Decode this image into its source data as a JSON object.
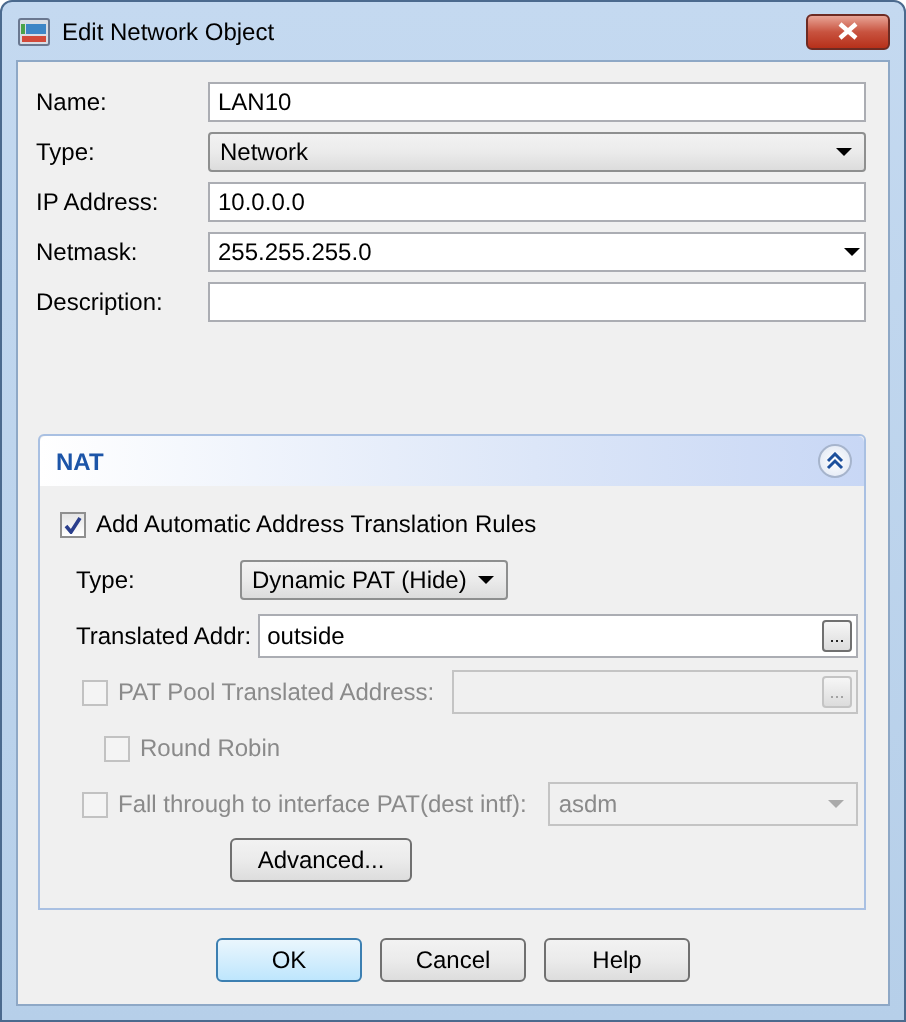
{
  "window": {
    "title": "Edit Network Object"
  },
  "fields": [
    {
      "label": "Name:",
      "kind": "text",
      "value": "LAN10"
    },
    {
      "label": "Type:",
      "kind": "select",
      "value": "Network"
    },
    {
      "label": "IP Address:",
      "kind": "text",
      "value": "10.0.0.0"
    },
    {
      "label": "Netmask:",
      "kind": "combo",
      "value": "255.255.255.0"
    },
    {
      "label": "Description:",
      "kind": "text"
    }
  ],
  "nat": {
    "title": "NAT",
    "expanded": true,
    "auto_rules": {
      "label": "Add Automatic Address Translation Rules",
      "checked": true,
      "disabled": false
    },
    "type": {
      "label": "Type:",
      "value": "Dynamic PAT (Hide)"
    },
    "translated_addr": {
      "label": "Translated Addr:",
      "value": "outside",
      "browse": "..."
    },
    "pat_pool": {
      "label": "PAT Pool Translated Address:",
      "checked": false,
      "disabled": true,
      "browse": "..."
    },
    "round_robin": {
      "label": "Round Robin",
      "checked": false,
      "disabled": true
    },
    "fall_through": {
      "label": "Fall through to interface PAT(dest intf):",
      "checked": false,
      "disabled": true,
      "value": "asdm"
    },
    "advanced": "Advanced..."
  },
  "buttons": [
    {
      "label": "OK",
      "default": true
    },
    {
      "label": "Cancel",
      "default": false
    },
    {
      "label": "Help",
      "default": false
    }
  ]
}
